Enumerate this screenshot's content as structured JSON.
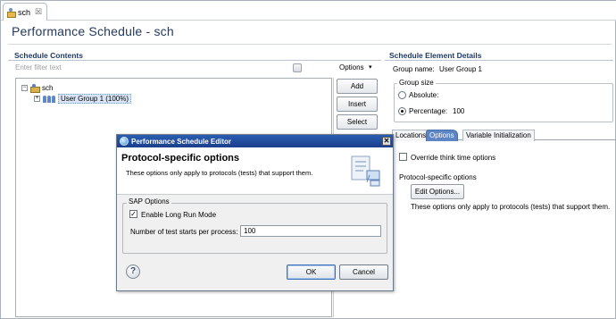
{
  "tab": {
    "label": "sch",
    "close_glyph": "☒"
  },
  "page_title": "Performance Schedule - sch",
  "left": {
    "section_title": "Schedule Contents",
    "filter_placeholder": "Enter filter text",
    "options_label": "Options",
    "options_caret": "▾",
    "tree": [
      {
        "label": "sch",
        "expander": "−",
        "icon": "schedule-icon"
      },
      {
        "label": "User Group 1 (100%)",
        "expander": "+",
        "icon": "user-group-icon"
      }
    ],
    "buttons": {
      "add": "Add",
      "insert": "Insert",
      "select": "Select"
    }
  },
  "right": {
    "section_title": "Schedule Element Details",
    "group_name_label": "Group name:",
    "group_name_value": "User Group 1",
    "group_size": {
      "legend": "Group size",
      "absolute_label": "Absolute:",
      "percentage_label": "Percentage:",
      "percentage_value": "100",
      "selected": "percentage"
    },
    "tabs": [
      "Locations",
      "Options",
      "Variable Initialization"
    ],
    "active_tab": "Options",
    "override_label": "Override think time options",
    "protocol_label": "Protocol-specific options",
    "edit_options_label": "Edit Options...",
    "protocol_note": "These options only apply to protocols (tests) that support them."
  },
  "dialog": {
    "title": "Performance Schedule Editor",
    "close_glyph": "✕",
    "header_title": "Protocol-specific options",
    "header_desc": "These options only apply to protocols (tests) that support them.",
    "sap_legend": "SAP Options",
    "long_run_label": "Enable Long Run Mode",
    "long_run_checked": true,
    "starts_label": "Number of test starts per process:",
    "starts_value": "100",
    "help_glyph": "?",
    "ok_label": "OK",
    "cancel_label": "Cancel"
  },
  "colors": {
    "title": "#243a5e",
    "section": "#1f3a64",
    "accent_tab": "#5b85c5",
    "dialog_titlebar": "#1a3f8c"
  }
}
